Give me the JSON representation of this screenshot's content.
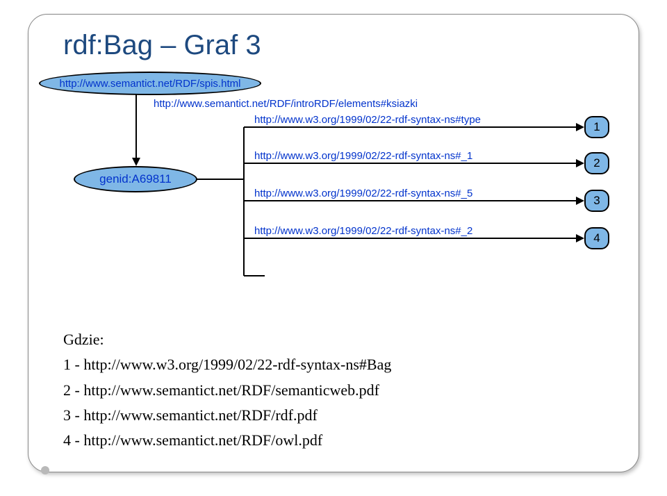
{
  "title": "rdf:Bag – Graf 3",
  "diagram": {
    "node_spis": {
      "text": "http://www.semantict.net/RDF/spis.html",
      "color": "#0233cc",
      "bg": "#7fb7e6"
    },
    "node_genid": {
      "text": "genid:A69811",
      "color": "#0233cc",
      "bg": "#7fb7e6"
    },
    "edge_ksiazki": {
      "text": "http://www.semantict.net/RDF/introRDF/elements#ksiazki",
      "color": "#0233cc"
    },
    "edge_type": {
      "text": "http://www.w3.org/1999/02/22-rdf-syntax-ns#type",
      "color": "#0233cc"
    },
    "edge_1": {
      "text": "http://www.w3.org/1999/02/22-rdf-syntax-ns#_1",
      "color": "#0233cc"
    },
    "edge_5": {
      "text": "http://www.w3.org/1999/02/22-rdf-syntax-ns#_5",
      "color": "#0233cc"
    },
    "edge_2": {
      "text": "http://www.w3.org/1999/02/22-rdf-syntax-ns#_2",
      "color": "#0233cc"
    },
    "box1": {
      "text": "1",
      "bg": "#7fb7e6"
    },
    "box2": {
      "text": "2",
      "bg": "#7fb7e6"
    },
    "box3": {
      "text": "3",
      "bg": "#7fb7e6"
    },
    "box4": {
      "text": "4",
      "bg": "#7fb7e6"
    }
  },
  "legend": {
    "heading": "Gdzie:",
    "line1": "1 - http://www.w3.org/1999/02/22-rdf-syntax-ns#Bag",
    "line2": "2 - http://www.semantict.net/RDF/semanticweb.pdf",
    "line3": "3 - http://www.semantict.net/RDF/rdf.pdf",
    "line4": "4 - http://www.semantict.net/RDF/owl.pdf"
  }
}
